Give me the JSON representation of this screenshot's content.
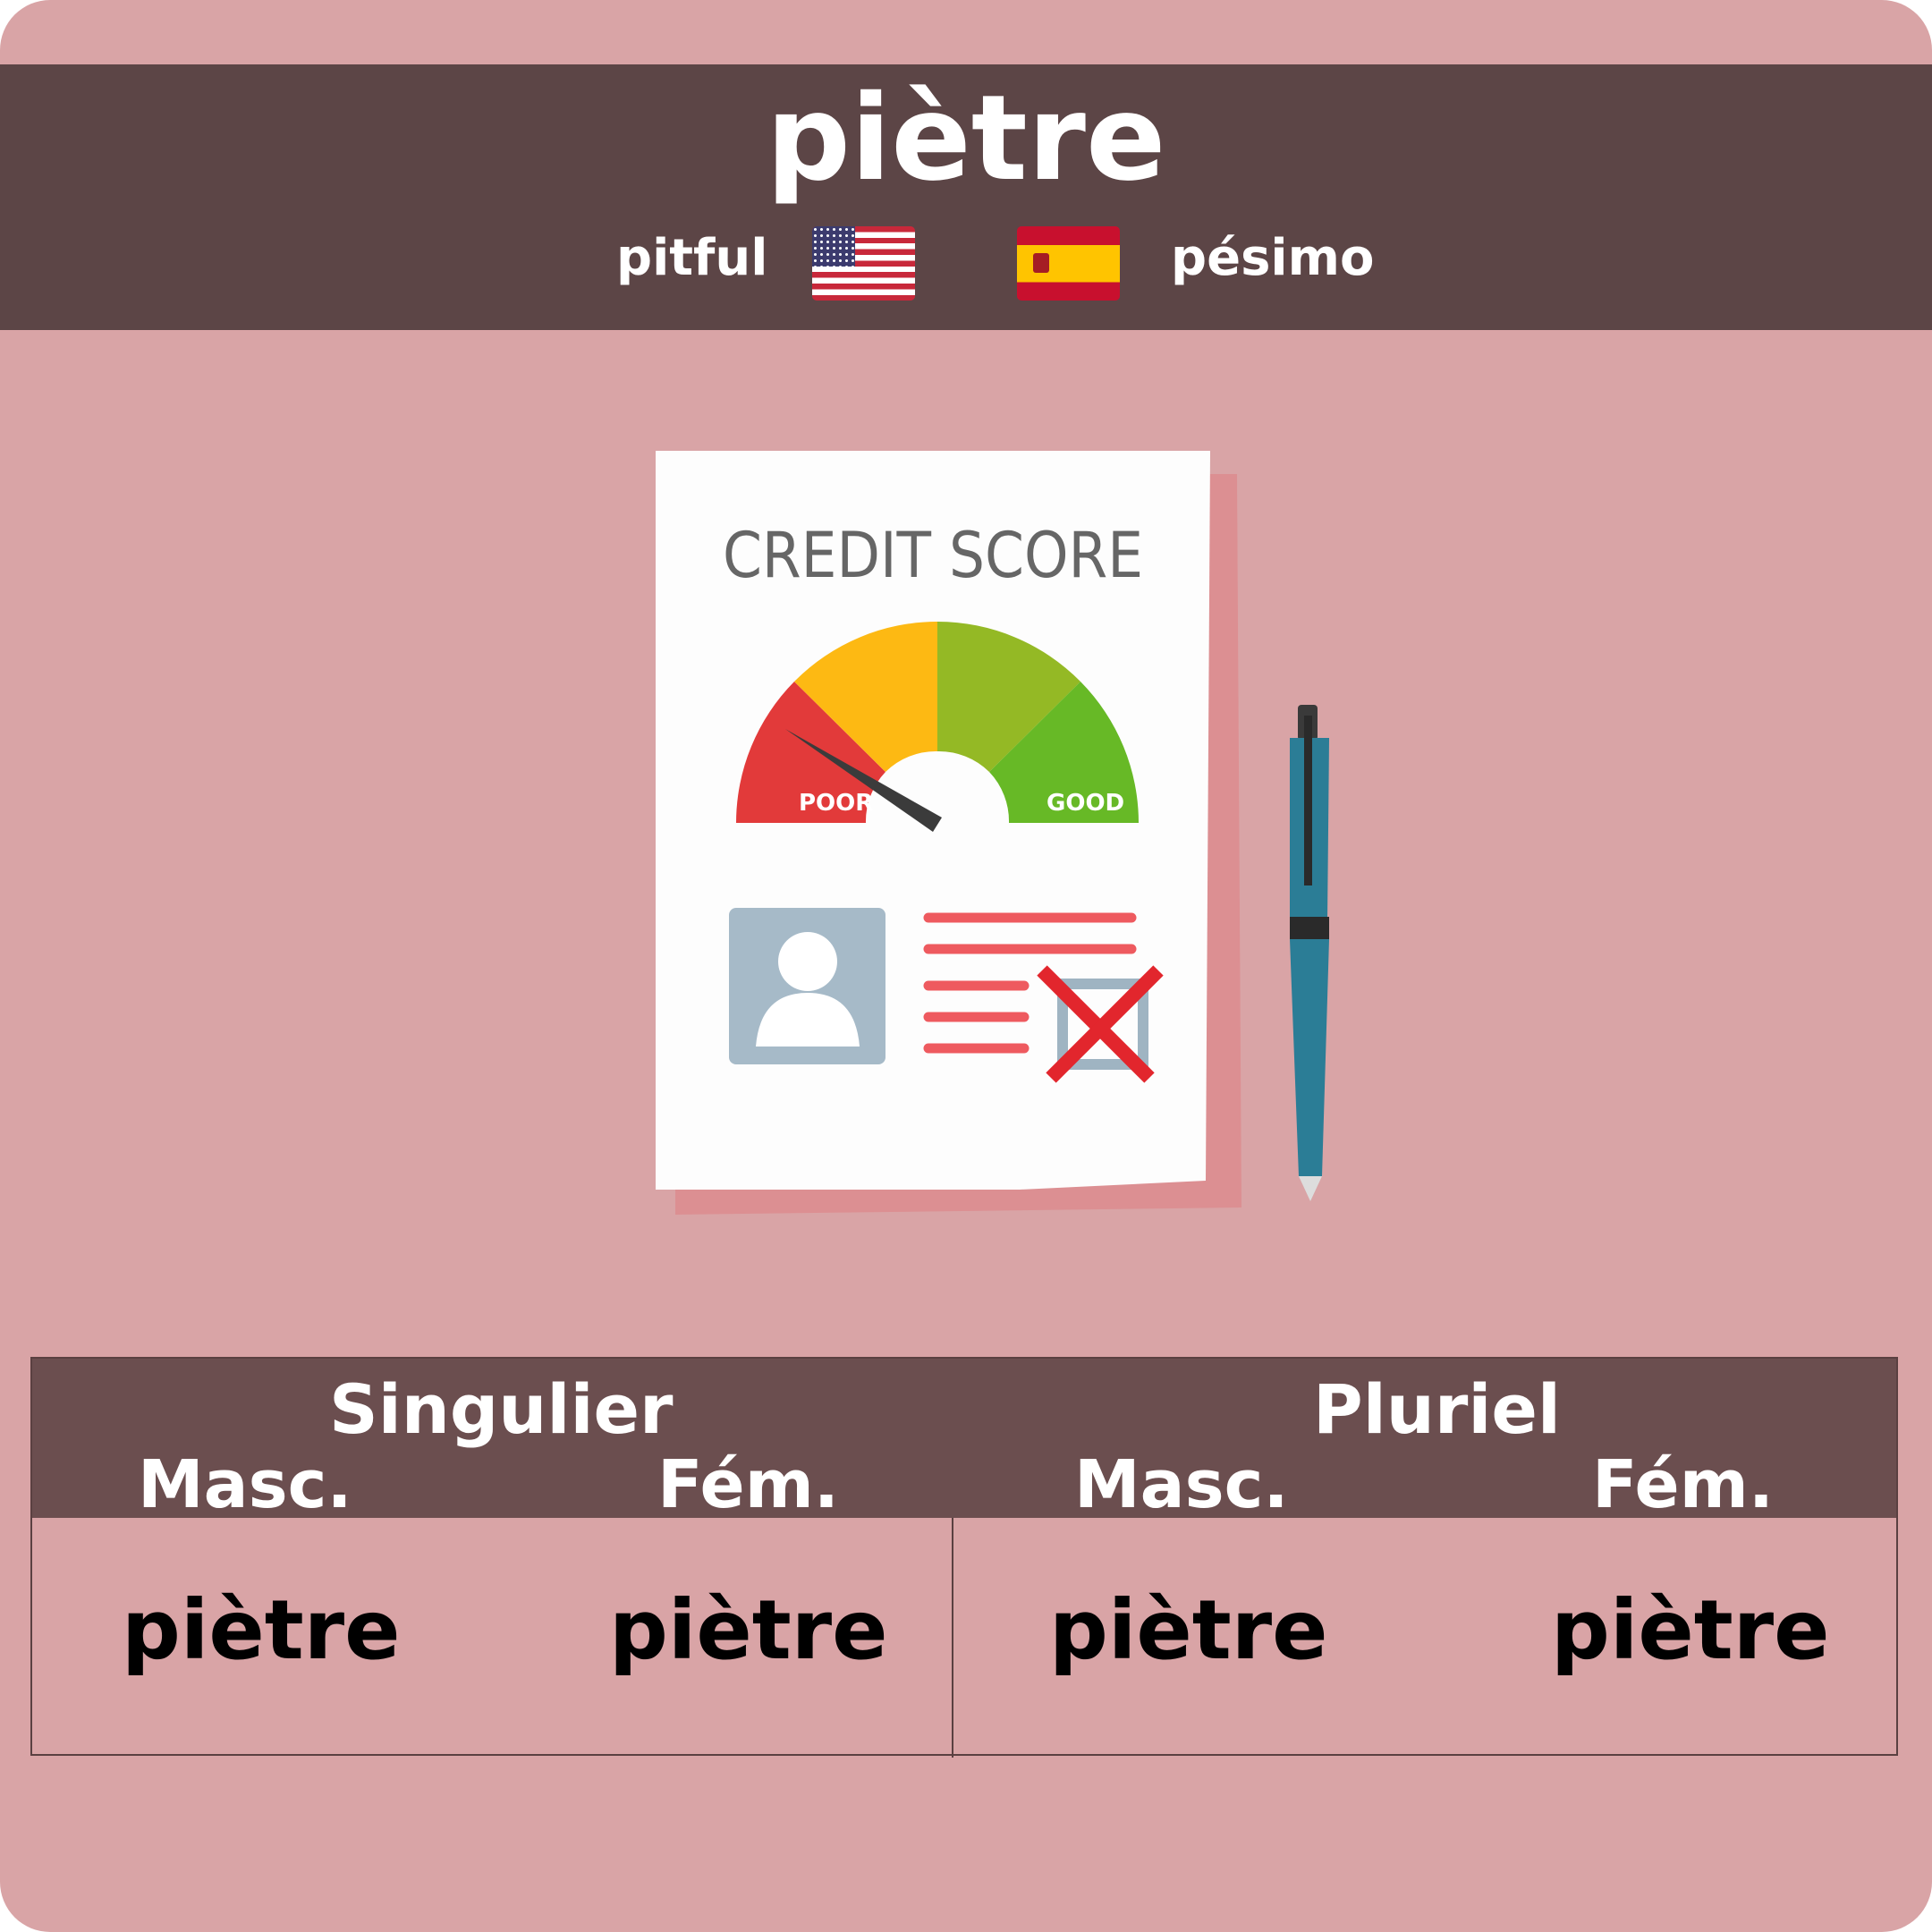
{
  "title": "piètre",
  "translations": {
    "english": "pitful",
    "spanish": "pésimo"
  },
  "flags": {
    "english": "us-flag",
    "spanish": "spain-flag"
  },
  "illustration": {
    "heading": "CREDIT SCORE",
    "gauge_low": "POOR",
    "gauge_high": "GOOD"
  },
  "table": {
    "groups": [
      "Singulier",
      "Pluriel"
    ],
    "subheaders": [
      "Masc.",
      "Fém.",
      "Masc.",
      "Fém."
    ],
    "cells": [
      "piètre",
      "piètre",
      "piètre",
      "piètre"
    ]
  },
  "colors": {
    "background": "#d9a4a6",
    "header": "#5c4546",
    "table_header": "#6b4e4f"
  }
}
